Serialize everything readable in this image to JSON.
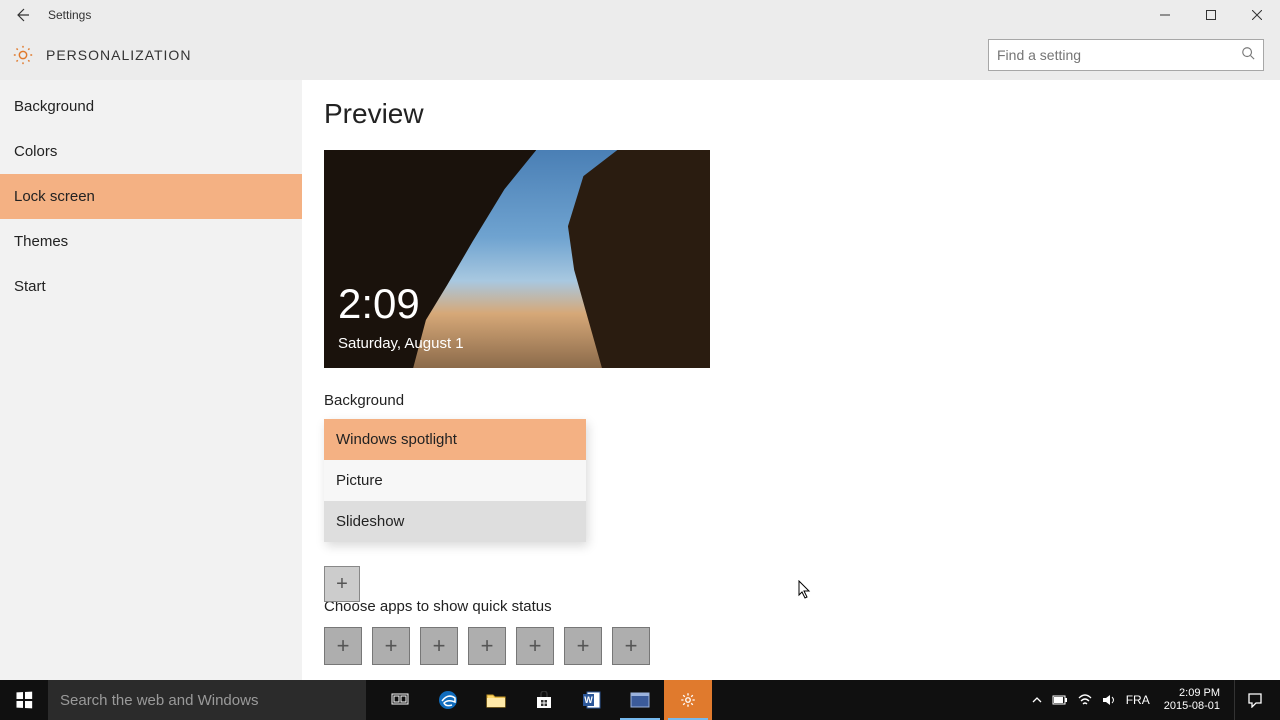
{
  "titlebar": {
    "title": "Settings"
  },
  "header": {
    "category": "PERSONALIZATION",
    "search_placeholder": "Find a setting"
  },
  "sidebar": {
    "items": [
      {
        "label": "Background",
        "selected": false
      },
      {
        "label": "Colors",
        "selected": false
      },
      {
        "label": "Lock screen",
        "selected": true
      },
      {
        "label": "Themes",
        "selected": false
      },
      {
        "label": "Start",
        "selected": false
      }
    ]
  },
  "content": {
    "preview_heading": "Preview",
    "preview_time": "2:09",
    "preview_date": "Saturday, August 1",
    "background_label": "Background",
    "background_options": [
      {
        "label": "Windows spotlight",
        "state": "selected"
      },
      {
        "label": "Picture",
        "state": ""
      },
      {
        "label": "Slideshow",
        "state": "hover"
      }
    ],
    "quick_status_label": "Choose apps to show quick status",
    "quick_status_slots": 7
  },
  "taskbar": {
    "search_placeholder": "Search the web and Windows",
    "apps": [
      {
        "name": "task-view"
      },
      {
        "name": "edge"
      },
      {
        "name": "file-explorer"
      },
      {
        "name": "store"
      },
      {
        "name": "word"
      },
      {
        "name": "screen-sketch",
        "active": true
      },
      {
        "name": "settings",
        "orange": true,
        "active": true
      }
    ],
    "lang": "FRA",
    "time": "2:09 PM",
    "date": "2015-08-01"
  }
}
